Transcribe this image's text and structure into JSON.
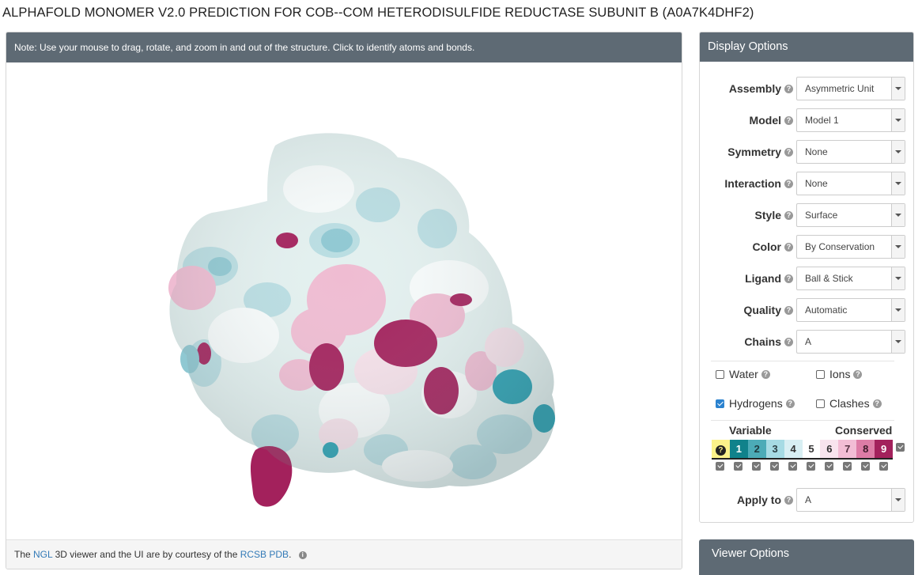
{
  "page": {
    "title": "ALPHAFOLD MONOMER V2.0 PREDICTION FOR COB--COM HETERODISULFIDE REDUCTASE SUBUNIT B (A0A7K4DHF2)"
  },
  "viewer": {
    "note": "Note: Use your mouse to drag, rotate, and zoom in and out of the structure. Click to identify atoms and bonds.",
    "footer": {
      "prefix": "The ",
      "ngl_link": "NGL",
      "middle": " 3D viewer and the UI are by courtesy of the ",
      "rcsb_link": "RCSB PDB",
      "suffix": "."
    }
  },
  "display_options": {
    "heading": "Display Options",
    "rows": [
      {
        "label": "Assembly",
        "value": "Asymmetric Unit"
      },
      {
        "label": "Model",
        "value": "Model 1"
      },
      {
        "label": "Symmetry",
        "value": "None"
      },
      {
        "label": "Interaction",
        "value": "None"
      },
      {
        "label": "Style",
        "value": "Surface"
      },
      {
        "label": "Color",
        "value": "By Conservation"
      },
      {
        "label": "Ligand",
        "value": "Ball & Stick"
      },
      {
        "label": "Quality",
        "value": "Automatic"
      },
      {
        "label": "Chains",
        "value": "A"
      }
    ],
    "checkboxes": {
      "water": {
        "label": "Water",
        "checked": false
      },
      "ions": {
        "label": "Ions",
        "checked": false
      },
      "hydrogens": {
        "label": "Hydrogens",
        "checked": true
      },
      "clashes": {
        "label": "Clashes",
        "checked": false
      }
    },
    "scale": {
      "variable_label": "Variable",
      "conserved_label": "Conserved",
      "cells": [
        {
          "text": "?",
          "bg": "#fbf28a",
          "fg": "#222"
        },
        {
          "text": "1",
          "bg": "#10828b",
          "fg": "#ffffff"
        },
        {
          "text": "2",
          "bg": "#4cabb7",
          "fg": "#1f3b40"
        },
        {
          "text": "3",
          "bg": "#a6dbe4",
          "fg": "#2b4045"
        },
        {
          "text": "4",
          "bg": "#d8eff3",
          "fg": "#333"
        },
        {
          "text": "5",
          "bg": "#ffffff",
          "fg": "#333"
        },
        {
          "text": "6",
          "bg": "#f8e4ee",
          "fg": "#333"
        },
        {
          "text": "7",
          "bg": "#f2bdd5",
          "fg": "#553344"
        },
        {
          "text": "8",
          "bg": "#dd7ca6",
          "fg": "#3d1a2a"
        },
        {
          "text": "9",
          "bg": "#a3215c",
          "fg": "#ffffff"
        }
      ]
    },
    "apply_to": {
      "label": "Apply to",
      "value": "A"
    }
  },
  "viewer_options": {
    "heading": "Viewer Options"
  },
  "colors": {
    "panel_header": "#5e6a74",
    "link": "#337ab7",
    "checkbox_checked": "#2b82cf"
  }
}
